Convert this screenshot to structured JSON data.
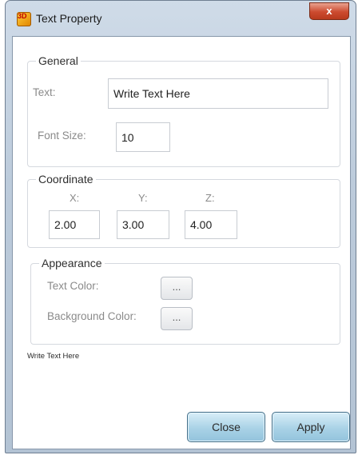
{
  "window": {
    "title": "Text Property",
    "close_glyph": "x"
  },
  "general": {
    "legend": "General",
    "text_label": "Text:",
    "text_value": "Write Text Here",
    "font_size_label": "Font Size:",
    "font_size_value": "10"
  },
  "coordinate": {
    "legend": "Coordinate",
    "x_label": "X:",
    "y_label": "Y:",
    "z_label": "Z:",
    "x_value": "2.00",
    "y_value": "3.00",
    "z_value": "4.00"
  },
  "appearance": {
    "legend": "Appearance",
    "text_color_label": "Text Color:",
    "background_color_label": "Background Color:",
    "button_glyph": "..."
  },
  "preview_text": "Write Text Here",
  "buttons": {
    "close": "Close",
    "apply": "Apply"
  },
  "colors": {
    "title_bar": "#c3d1e0",
    "close_button": "#cc4a2f",
    "action_button": "#a9d2e6"
  }
}
